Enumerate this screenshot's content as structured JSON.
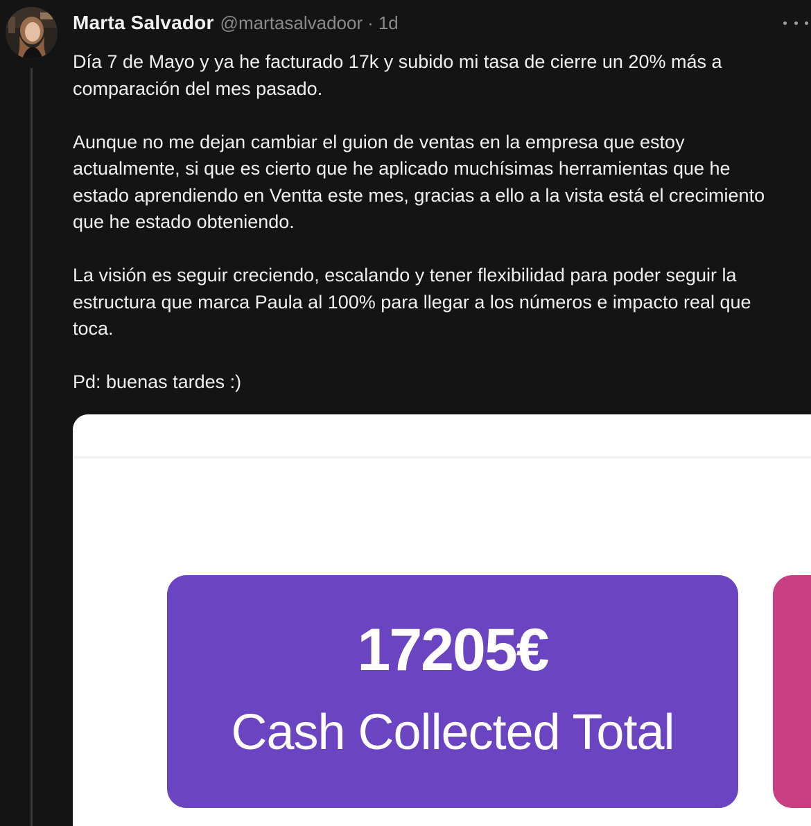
{
  "post": {
    "author_name": "Marta Salvador",
    "author_handle": "@martasalvadoor",
    "separator": "·",
    "timestamp": "1d",
    "paragraphs": [
      "Día 7 de Mayo y ya he facturado 17k y subido mi tasa de cierre un 20% más a\ncomparación del mes pasado.",
      "Aunque no me dejan cambiar el guion de ventas en la empresa que estoy\nactualmente, si que es cierto que he aplicado muchísimas herramientas que he\nestado aprendiendo en Ventta este mes, gracias a ello a la vista está el crecimiento\nque he estado obteniendo.",
      "La visión es seguir creciendo, escalando y tener flexibilidad para poder seguir la\nestructura que marca Paula al 100% para llegar a los números e impacto real que\ntoca.",
      "Pd: buenas tardes :)"
    ]
  },
  "media": {
    "stat_value": "17205€",
    "stat_label": "Cash Collected Total"
  },
  "icons": {
    "avatar": "profile-photo",
    "more": "more-horizontal-icon"
  },
  "colors": {
    "background": "#141414",
    "text": "#f0f0f0",
    "muted": "#8a8a8a",
    "tile_purple": "#6a44c1",
    "tile_pink": "#c93f84"
  }
}
